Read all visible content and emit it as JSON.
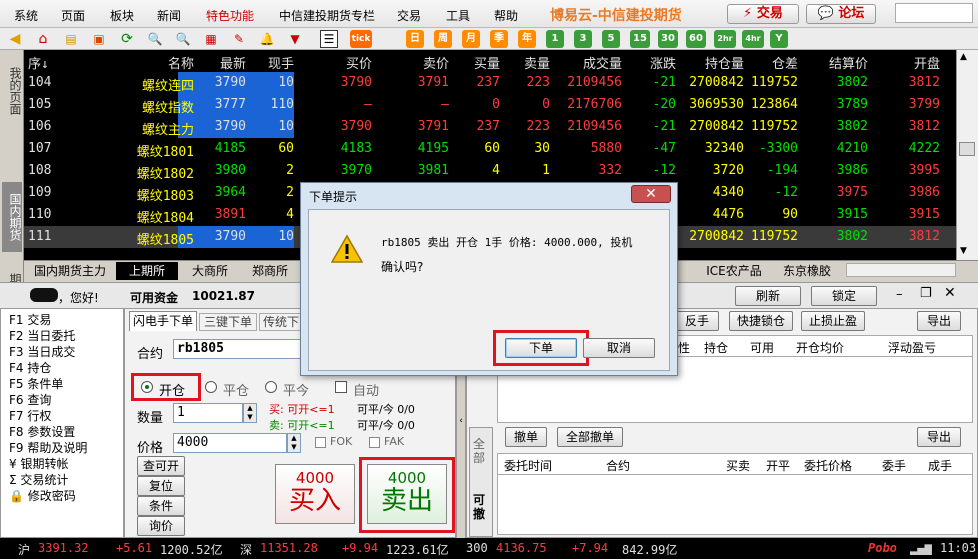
{
  "menubar": {
    "items": [
      "系统",
      "页面",
      "板块",
      "新闻",
      "特色功能",
      "中信建投期货专栏",
      "交易",
      "工具",
      "帮助"
    ],
    "brand": "博易云-中信建投期货",
    "trade_btn": "交易",
    "forum_btn": "论坛"
  },
  "toolbar": {
    "periods": [
      "tick",
      "日",
      "周",
      "月",
      "季",
      "年",
      "1",
      "3",
      "5",
      "15",
      "30",
      "60",
      "2hr",
      "4hr",
      "Y"
    ]
  },
  "side_tabs": [
    "我的页面",
    "国内期货",
    "期权报价"
  ],
  "quote_table": {
    "headers": [
      "序↓",
      "名称",
      "最新",
      "现手",
      "买价",
      "卖价",
      "买量",
      "卖量",
      "成交量",
      "涨跌",
      "持仓量",
      "仓差",
      "结算价",
      "开盘"
    ],
    "rows": [
      [
        "104",
        "螺纹连四",
        "3790",
        "10",
        "3790",
        "3791",
        "237",
        "223",
        "2109456",
        "-21",
        "2700842",
        "119752",
        "3802",
        "3812"
      ],
      [
        "105",
        "螺纹指数",
        "3777",
        "110",
        "—",
        "—",
        "0",
        "0",
        "2176706",
        "-20",
        "3069530",
        "123864",
        "3789",
        "3799"
      ],
      [
        "106",
        "螺纹主力",
        "3790",
        "10",
        "3790",
        "3791",
        "237",
        "223",
        "2109456",
        "-21",
        "2700842",
        "119752",
        "3802",
        "3812"
      ],
      [
        "107",
        "螺纹1801",
        "4185",
        "60",
        "4183",
        "4195",
        "60",
        "30",
        "5880",
        "-47",
        "32340",
        "-3300",
        "4210",
        "4222"
      ],
      [
        "108",
        "螺纹1802",
        "3980",
        "2",
        "3970",
        "3981",
        "4",
        "1",
        "332",
        "-12",
        "3720",
        "-194",
        "3986",
        "3995"
      ],
      [
        "109",
        "螺纹1803",
        "3964",
        "2",
        "",
        "",
        "",
        "",
        "",
        "",
        "4340",
        "-12",
        "3975",
        "3986"
      ],
      [
        "110",
        "螺纹1804",
        "3891",
        "4",
        "",
        "",
        "",
        "",
        "",
        "",
        "4476",
        "90",
        "3915",
        "3915"
      ],
      [
        "111",
        "螺纹1805",
        "3790",
        "10",
        "",
        "",
        "",
        "",
        "",
        "",
        "2700842",
        "119752",
        "3802",
        "3812"
      ]
    ]
  },
  "exchange_tabs": [
    "国内期货主力",
    "上期所",
    "大商所",
    "郑商所",
    "ICE农产品",
    "东京橡胶"
  ],
  "account": {
    "greeting": "，您好!",
    "funds_label": "可用资金",
    "funds_value": "10021.87",
    "refresh": "刷新",
    "lock": "锁定"
  },
  "tree": {
    "items": [
      "F1 交易",
      "F2 当日委托",
      "F3 当日成交",
      "F4 持仓",
      "F5 条件单",
      "F6 查询",
      "F7 行权",
      "F8 参数设置",
      "F9 帮助及说明",
      "¥ 银期转帐",
      "Σ 交易统计",
      "🔒 修改密码"
    ]
  },
  "order_form": {
    "tabs": [
      "闪电手下单",
      "三键下单",
      "传统下"
    ],
    "contract_label": "合约",
    "contract_value": "rb1805",
    "open_label": "开仓",
    "close_label": "平仓",
    "close_today_label": "平今",
    "auto_label": "自动",
    "qty_label": "数量",
    "qty_value": "1",
    "price_label": "价格",
    "price_value": "4000",
    "buy_hint_1": "买: 可开<=1",
    "buy_hint_2": "可平/今 0/0",
    "sell_hint_1": "卖: 可开<=1",
    "sell_hint_2": "可平/今 0/0",
    "fok": "FOK",
    "fak": "FAK",
    "side_buttons": [
      "查可开",
      "复位",
      "条件",
      "询价"
    ],
    "buy_price": "4000",
    "buy_label": "买入",
    "sell_price": "4000",
    "sell_label": "卖出"
  },
  "right_panel": {
    "buttons_top": [
      "反手",
      "快捷锁仓",
      "止损止盈",
      "导出"
    ],
    "pos_headers": [
      "性",
      "持仓",
      "可用",
      "开仓均价",
      "浮动盈亏"
    ],
    "side_tabs": [
      "全部",
      "可撤"
    ],
    "cancel_btn": "撤单",
    "cancel_all_btn": "全部撤单",
    "export_btn": "导出",
    "order_headers": [
      "委托时间",
      "合约",
      "买卖",
      "开平",
      "委托价格",
      "委手",
      "成手"
    ]
  },
  "dialog": {
    "title": "下单提示",
    "message_line1": "rb1805 卖出 开仓 1手 价格: 4000.000, 投机",
    "message_line2": "确认吗?",
    "ok": "下单",
    "cancel": "取消"
  },
  "statusbar": {
    "sh_label": "沪",
    "sh_value": "3391.32",
    "sh_change": "+5.61",
    "sh_amount": "1200.52亿",
    "sz_label": "深",
    "sz_value": "11351.28",
    "sz_change": "+9.94",
    "sz_amount": "1223.61亿",
    "i300_label": "300",
    "i300_value": "4136.75",
    "i300_change": "+7.94",
    "i300_amount": "842.99亿",
    "brand": "Pobo",
    "time": "11:03"
  }
}
